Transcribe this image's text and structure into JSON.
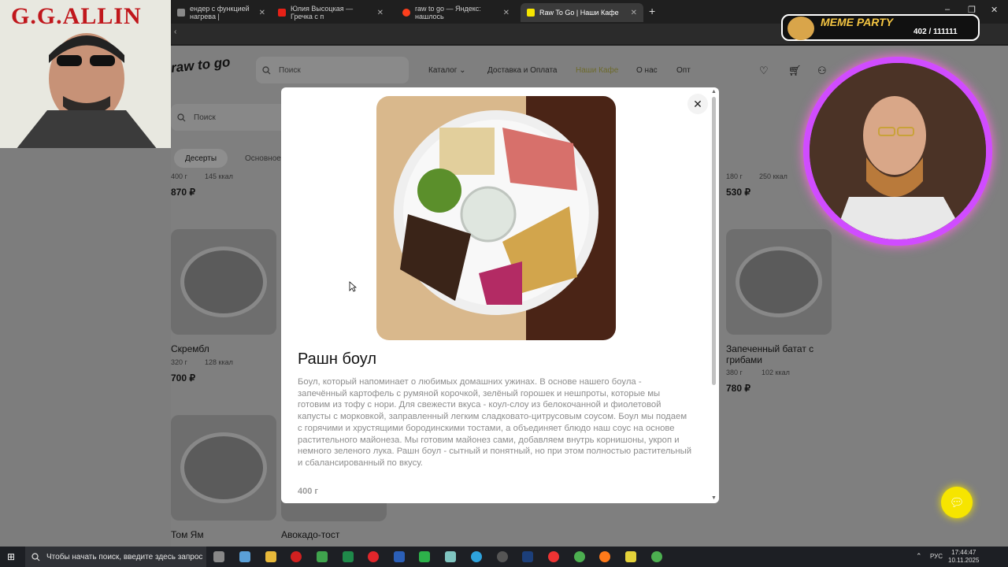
{
  "browser": {
    "tabs": [
      {
        "label": "ендер с функцией нагрева |",
        "icon": "page-icon"
      },
      {
        "label": "Юлия Высоцкая — Гречка с п",
        "icon": "youtube-icon"
      },
      {
        "label": "raw to go — Яндекс: нашлось",
        "icon": "yandex-icon"
      },
      {
        "label": "Raw To Go | Наши Кафе",
        "icon": "rawtogo-icon"
      }
    ],
    "new_tab": "+",
    "window_controls": [
      "–",
      "❐",
      "✕"
    ]
  },
  "site": {
    "logo": "raw to go",
    "search_placeholder": "Поиск",
    "nav": [
      {
        "label": "Каталог"
      },
      {
        "label": "Доставка и Оплата"
      },
      {
        "label": "Наши Кафе"
      },
      {
        "label": "О нас"
      },
      {
        "label": "Опт"
      }
    ],
    "filter_search_placeholder": "Поиск",
    "categories": [
      "Десерты",
      "Основное б"
    ],
    "top_row": [
      {
        "weight": "400 г",
        "kcal": "145 ккал",
        "price": "870 ₽"
      },
      {
        "weight": "180 г",
        "kcal": "250 ккал",
        "price": "530 ₽"
      }
    ],
    "products": [
      {
        "name": "Скрембл",
        "weight": "320 г",
        "kcal": "128 ккал",
        "price": "700 ₽"
      },
      {
        "name": "Запеченный батат с грибами",
        "weight": "380 г",
        "kcal": "102 ккал",
        "price": "780 ₽"
      },
      {
        "name": "Том Ям"
      },
      {
        "name": "Авокадо-тост"
      }
    ]
  },
  "modal": {
    "title": "Рашн боул",
    "description": "Боул, который напоминает о любимых домашних ужинах. В основе нашего боула - запечённый картофель с румяной корочкой, зелёный горошек и нешпроты, которые мы готовим из тофу с нори. Для свежести вкуса - коул-слоу из белокочанной и фиолетовой капусты с морковкой, заправленный легким сладковато-цитрусовым соусом. Боул мы подаем с горячими и хрустящими бородинскими тостами, а объединяет блюдо наш соус на основе растительного майонеза. Мы готовим майонез сами, добавляем внутрь корнишоны, укроп и немного зеленого лука. Рашн боул - сытный и понятный, но при этом полностью растительный и сбалансированный по вкусу.",
    "weight": "400 г",
    "close": "✕"
  },
  "overlays": {
    "gg_allin": "G.G.ALLIN",
    "meme_party": "MEME PARTY",
    "meme_count": "402 / 111111"
  },
  "taskbar": {
    "search_placeholder": "Чтобы начать поиск, введите здесь запрос",
    "lang": "РУС",
    "time": "17:44:47",
    "date": "10.11.2025"
  },
  "colors": {
    "accent_yellow": "#f6e500",
    "nav_active": "#6d6a2b",
    "gg_red": "#c0171c"
  }
}
